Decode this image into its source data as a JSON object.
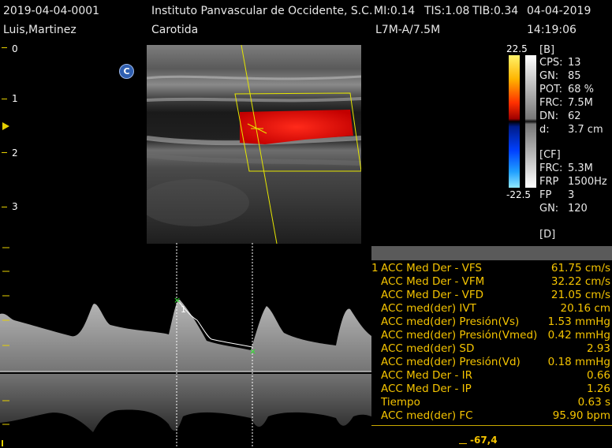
{
  "header": {
    "patient_id": "2019-04-04-0001",
    "institution": "Instituto Panvascular de Occidente, S.C.",
    "mi": "MI:0.14",
    "tis": "TIS:1.08",
    "tib": "TIB:0.34",
    "date": "04-04-2019",
    "patient_name": "Luis,Martinez",
    "exam": "Carotida",
    "probe": "L7M-A/7.5M",
    "time": "14:19:06"
  },
  "depth_scale": {
    "labels": [
      "0",
      "1",
      "2",
      "3"
    ]
  },
  "badge": {
    "label": "C"
  },
  "color_scale": {
    "max": "22.5",
    "min": "-22.5"
  },
  "b_mode": {
    "title": "[B]",
    "params": [
      {
        "k": "CPS:",
        "v": "13"
      },
      {
        "k": "GN:",
        "v": "85"
      },
      {
        "k": "POT:",
        "v": "68 %"
      },
      {
        "k": "FRC:",
        "v": "7.5M"
      },
      {
        "k": "DN:",
        "v": "62"
      },
      {
        "k": "d:",
        "v": "3.7 cm"
      }
    ]
  },
  "cf_mode": {
    "title": "[CF]",
    "params": [
      {
        "k": "FRC:",
        "v": "5.3M"
      },
      {
        "k": "FRP",
        "v": "1500Hz"
      },
      {
        "k": "FP",
        "v": "3"
      },
      {
        "k": "GN:",
        "v": "120"
      }
    ]
  },
  "d_mode": {
    "title": "[D]"
  },
  "measurements": {
    "index": "1",
    "rows": [
      {
        "label": "ACC Med Der - VFS",
        "value": "61.75 cm/s"
      },
      {
        "label": "ACC Med Der - VFM",
        "value": "32.22 cm/s"
      },
      {
        "label": "ACC Med Der - VFD",
        "value": "21.05 cm/s"
      },
      {
        "label": "ACC med(der) IVT",
        "value": "20.16 cm"
      },
      {
        "label": "ACC med(der) Presión(Vs)",
        "value": "1.53 mmHg"
      },
      {
        "label": "ACC med(der) Presión(Vmed)",
        "value": "0.42 mmHg"
      },
      {
        "label": "ACC med(der) SD",
        "value": "2.93"
      },
      {
        "label": "ACC med(der) Presión(Vd)",
        "value": "0.18 mmHg"
      },
      {
        "label": "ACC Med Der - IR",
        "value": "0.66"
      },
      {
        "label": "ACC Med Der - IP",
        "value": "1.26"
      },
      {
        "label": "Tiempo",
        "value": "0.63 s"
      },
      {
        "label": "ACC med(der) FC",
        "value": "95.90 bpm"
      }
    ]
  },
  "doppler": {
    "cursor_marker": "1",
    "bottom_value": "-67,4"
  },
  "colors": {
    "accent_yellow": "#f5c400",
    "flow_red": "#e01010",
    "header_text": "#e8e8e8"
  }
}
